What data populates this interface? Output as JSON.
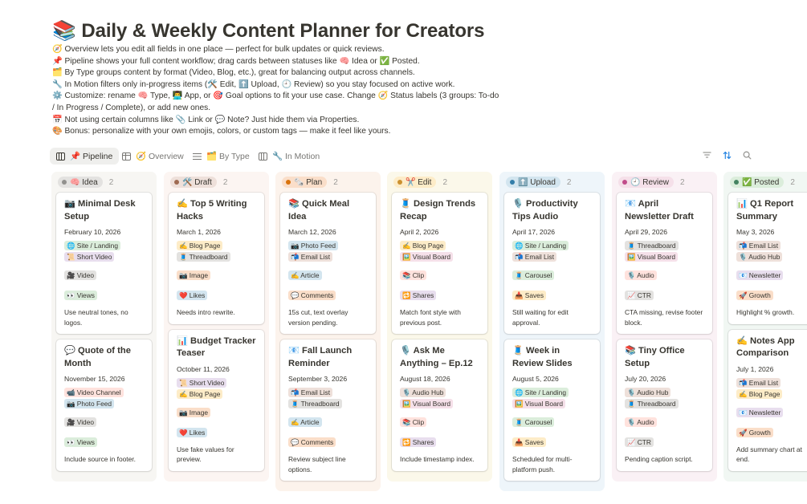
{
  "page": {
    "title": "📚 Daily & Weekly Content Planner for Creators",
    "description": [
      "🧭 Overview lets you edit all fields in one place — perfect for bulk updates or quick reviews.",
      "📌 Pipeline shows your full content workflow; drag cards between statuses like 🧠 Idea or ✅ Posted.",
      "🗂️ By Type groups content by format (Video, Blog, etc.), great for balancing output across channels.",
      "🔧 In Motion filters only in-progress items (🛠️ Edit, ⬆️ Upload, 🕘 Review) so you stay focused on active work.",
      "⚙️ Customize: rename 🧠 Type, 👨‍💻 App, or 🎯 Goal options to fit your use case. Change 🧭 Status labels (3 groups: To-do / In Progress / Complete), or add new ones.",
      "📅 Not using certain columns like 📎 Link or 💬 Note? Just hide them via Properties.",
      "🎨 Bonus: personalize with your own emojis, colors, or custom tags — make it feel like yours."
    ]
  },
  "views": [
    {
      "icon": "board-icon",
      "label": "📌 Pipeline",
      "active": true
    },
    {
      "icon": "table-icon",
      "label": "🧭 Overview",
      "active": false
    },
    {
      "icon": "list-icon",
      "label": "🗂️ By Type",
      "active": false
    },
    {
      "icon": "board-icon",
      "label": "🔧 In Motion",
      "active": false
    }
  ],
  "toolbar": {
    "filter_icon": "filter-icon",
    "sort_icon": "sort-icon",
    "search_icon": "search-icon"
  },
  "tag_colors": {
    "green": "#dbeddb",
    "purple": "#e8deee",
    "gray": "#e3e2e0",
    "blue": "#d3e5ef",
    "orange": "#fadec9",
    "yellow": "#fdecc8",
    "red": "#ffe2dd",
    "pink": "#f5e0e9",
    "brown": "#eee0da"
  },
  "columns": [
    {
      "name": "🧠 Idea",
      "count": "2",
      "bg": "#f7f6f3",
      "pill_bg": "#e3e2e0",
      "dot": "#91918e",
      "cards": [
        {
          "title": "📷 Minimal Desk Setup",
          "date": "February 10, 2026",
          "channels": [
            {
              "t": "🌐 Site / Landing",
              "c": "green"
            },
            {
              "t": "📜 Short Video",
              "c": "purple"
            }
          ],
          "format": {
            "t": "🎥 Video",
            "c": "gray"
          },
          "goal": {
            "t": "👀 Views",
            "c": "green"
          },
          "note": "Use neutral tones, no logos."
        },
        {
          "title": "💬 Quote of the Month",
          "date": "November 15, 2026",
          "channels": [
            {
              "t": "📹 Video Channel",
              "c": "red"
            },
            {
              "t": "📷 Photo Feed",
              "c": "blue"
            }
          ],
          "format": {
            "t": "🎥 Video",
            "c": "gray"
          },
          "goal": {
            "t": "👀 Views",
            "c": "green"
          },
          "note": "Include source in footer."
        }
      ]
    },
    {
      "name": "🛠️ Draft",
      "count": "2",
      "bg": "#fcf5f2",
      "pill_bg": "#eee0da",
      "dot": "#9f6b53",
      "cards": [
        {
          "title": "✍️ Top 5 Writing Hacks",
          "date": "March 1, 2026",
          "channels": [
            {
              "t": "✍️ Blog Page",
              "c": "yellow"
            },
            {
              "t": "🧵 Threadboard",
              "c": "gray"
            }
          ],
          "format": {
            "t": "📷 Image",
            "c": "orange"
          },
          "goal": {
            "t": "❤️ Likes",
            "c": "blue"
          },
          "note": "Needs intro rewrite."
        },
        {
          "title": "📊 Budget Tracker Teaser",
          "date": "October 11, 2026",
          "channels": [
            {
              "t": "📜 Short Video",
              "c": "purple"
            },
            {
              "t": "✍️ Blog Page",
              "c": "yellow"
            }
          ],
          "format": {
            "t": "📷 Image",
            "c": "orange"
          },
          "goal": {
            "t": "❤️ Likes",
            "c": "blue"
          },
          "note": "Use fake values for preview."
        }
      ]
    },
    {
      "name": "🗞️ Plan",
      "count": "2",
      "bg": "#fcf3ec",
      "pill_bg": "#fadec9",
      "dot": "#d9730d",
      "cards": [
        {
          "title": "📚 Quick Meal Idea",
          "date": "March 12, 2026",
          "channels": [
            {
              "t": "📷 Photo Feed",
              "c": "blue"
            },
            {
              "t": "📬 Email List",
              "c": "brown"
            }
          ],
          "format": {
            "t": "✍️ Article",
            "c": "blue"
          },
          "goal": {
            "t": "💬 Comments",
            "c": "orange"
          },
          "note": "15s cut, text overlay version pending."
        },
        {
          "title": "📧 Fall Launch Reminder",
          "date": "September 3, 2026",
          "channels": [
            {
              "t": "📬 Email List",
              "c": "brown"
            },
            {
              "t": "🧵 Threadboard",
              "c": "gray"
            }
          ],
          "format": {
            "t": "✍️ Article",
            "c": "blue"
          },
          "goal": {
            "t": "💬 Comments",
            "c": "orange"
          },
          "note": "Review subject line options."
        }
      ]
    },
    {
      "name": "✂️ Edit",
      "count": "2",
      "bg": "#fbf8ea",
      "pill_bg": "#fdecc8",
      "dot": "#cb912f",
      "cards": [
        {
          "title": "🧵 Design Trends Recap",
          "date": "April 2, 2026",
          "channels": [
            {
              "t": "✍️ Blog Page",
              "c": "yellow"
            },
            {
              "t": "🖼️ Visual Board",
              "c": "pink"
            }
          ],
          "format": {
            "t": "📚 Clip",
            "c": "red"
          },
          "goal": {
            "t": "🔁 Shares",
            "c": "purple"
          },
          "note": "Match font style with previous post."
        },
        {
          "title": "🎙️ Ask Me Anything – Ep.12",
          "date": "August 18, 2026",
          "channels": [
            {
              "t": "🎙️ Audio Hub",
              "c": "brown"
            },
            {
              "t": "🖼️ Visual Board",
              "c": "pink"
            }
          ],
          "format": {
            "t": "📚 Clip",
            "c": "red"
          },
          "goal": {
            "t": "🔁 Shares",
            "c": "purple"
          },
          "note": "Include timestamp index."
        }
      ]
    },
    {
      "name": "⬆️ Upload",
      "count": "2",
      "bg": "#eef5fa",
      "pill_bg": "#d3e5ef",
      "dot": "#337ea9",
      "cards": [
        {
          "title": "🎙️ Productivity Tips Audio",
          "date": "April 17, 2026",
          "channels": [
            {
              "t": "🌐 Site / Landing",
              "c": "green"
            },
            {
              "t": "📬 Email List",
              "c": "brown"
            }
          ],
          "format": {
            "t": "🧵 Carousel",
            "c": "green"
          },
          "goal": {
            "t": "📥 Saves",
            "c": "yellow"
          },
          "note": "Still waiting for edit approval."
        },
        {
          "title": "🧵 Week in Review Slides",
          "date": "August 5, 2026",
          "channels": [
            {
              "t": "🌐 Site / Landing",
              "c": "green"
            },
            {
              "t": "🖼️ Visual Board",
              "c": "pink"
            }
          ],
          "format": {
            "t": "🧵 Carousel",
            "c": "green"
          },
          "goal": {
            "t": "📥 Saves",
            "c": "yellow"
          },
          "note": "Scheduled for multi-platform push."
        }
      ]
    },
    {
      "name": "🕘 Review",
      "count": "2",
      "bg": "#faf1f5",
      "pill_bg": "#f5e0e9",
      "dot": "#c14c8a",
      "cards": [
        {
          "title": "📧 April Newsletter Draft",
          "date": "April 29, 2026",
          "channels": [
            {
              "t": "🧵 Threadboard",
              "c": "gray"
            },
            {
              "t": "🖼️ Visual Board",
              "c": "pink"
            }
          ],
          "format": {
            "t": "🎙️ Audio",
            "c": "red"
          },
          "goal": {
            "t": "📈 CTR",
            "c": "gray"
          },
          "note": "CTA missing, revise footer block."
        },
        {
          "title": "📚 Tiny Office Setup",
          "date": "July 20, 2026",
          "channels": [
            {
              "t": "🎙️ Audio Hub",
              "c": "brown"
            },
            {
              "t": "🧵 Threadboard",
              "c": "gray"
            }
          ],
          "format": {
            "t": "🎙️ Audio",
            "c": "red"
          },
          "goal": {
            "t": "📈 CTR",
            "c": "gray"
          },
          "note": "Pending caption script."
        }
      ]
    },
    {
      "name": "✅ Posted",
      "count": "2",
      "bg": "#f1f7f3",
      "pill_bg": "#dbeddb",
      "dot": "#448361",
      "cards": [
        {
          "title": "📊 Q1 Report Summary",
          "date": "May 3, 2026",
          "channels": [
            {
              "t": "📬 Email List",
              "c": "brown"
            },
            {
              "t": "🎙️ Audio Hub",
              "c": "brown"
            }
          ],
          "format": {
            "t": "📧 Newsletter",
            "c": "purple"
          },
          "goal": {
            "t": "🚀 Growth",
            "c": "orange"
          },
          "note": "Highlight % growth."
        },
        {
          "title": "✍️ Notes App Comparison",
          "date": "July 1, 2026",
          "channels": [
            {
              "t": "📬 Email List",
              "c": "brown"
            },
            {
              "t": "✍️ Blog Page",
              "c": "yellow"
            }
          ],
          "format": {
            "t": "📧 Newsletter",
            "c": "purple"
          },
          "goal": {
            "t": "🚀 Growth",
            "c": "orange"
          },
          "note": "Add summary chart at end."
        }
      ]
    }
  ]
}
